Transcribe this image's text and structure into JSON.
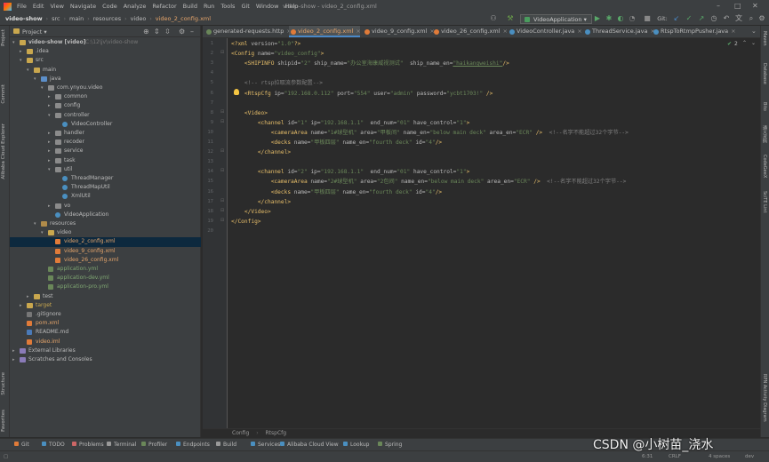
{
  "window": {
    "title": "video-show - video_2_config.xml",
    "menus": [
      "File",
      "Edit",
      "View",
      "Navigate",
      "Code",
      "Analyze",
      "Refactor",
      "Build",
      "Run",
      "Tools",
      "Git",
      "Window",
      "Help"
    ]
  },
  "breadcrumbs": [
    "video-show",
    "src",
    "main",
    "resources",
    "video",
    "video_2_config.xml"
  ],
  "toolbar": {
    "run_config": "VideoApplication",
    "git_label": "Git:"
  },
  "left_strip": [
    "Project",
    "Commit",
    "Alibaba Cloud Explorer",
    "Structure",
    "Favorites"
  ],
  "project_panel": {
    "title": "Project",
    "tree": [
      {
        "label": "video-show [video]",
        "extra": "C:\\12\\jv\\video-show",
        "type": "folder",
        "arrow": "▾"
      },
      {
        "label": ".idea",
        "type": "folder",
        "arrow": "▸"
      },
      {
        "label": "src",
        "type": "folder",
        "arrow": "▾"
      },
      {
        "label": "main",
        "type": "folder",
        "arrow": "▾"
      },
      {
        "label": "java",
        "type": "src",
        "arrow": "▾"
      },
      {
        "label": "com.ynyou.video",
        "type": "pkg",
        "arrow": "▾"
      },
      {
        "label": "common",
        "type": "pkg",
        "arrow": "▸"
      },
      {
        "label": "config",
        "type": "pkg",
        "arrow": "▸"
      },
      {
        "label": "controller",
        "type": "pkg",
        "arrow": "▾"
      },
      {
        "label": "VideoController",
        "type": "cls",
        "arrow": ""
      },
      {
        "label": "handler",
        "type": "pkg",
        "arrow": "▸"
      },
      {
        "label": "recoder",
        "type": "pkg",
        "arrow": "▸"
      },
      {
        "label": "service",
        "type": "pkg",
        "arrow": "▸"
      },
      {
        "label": "task",
        "type": "pkg",
        "arrow": "▸"
      },
      {
        "label": "util",
        "type": "pkg",
        "arrow": "▾"
      },
      {
        "label": "ThreadManager",
        "type": "cls",
        "arrow": ""
      },
      {
        "label": "ThreadMapUtil",
        "type": "cls",
        "arrow": ""
      },
      {
        "label": "XmlUtil",
        "type": "cls",
        "arrow": ""
      },
      {
        "label": "vo",
        "type": "pkg",
        "arrow": "▸"
      },
      {
        "label": "VideoApplication",
        "type": "cls",
        "arrow": ""
      },
      {
        "label": "resources",
        "type": "res",
        "arrow": "▾"
      },
      {
        "label": "video",
        "type": "folder",
        "arrow": "▾"
      },
      {
        "label": "video_2_config.xml",
        "type": "xml",
        "arrow": "",
        "selected": true
      },
      {
        "label": "video_9_config.xml",
        "type": "xml",
        "arrow": ""
      },
      {
        "label": "video_26_config.xml",
        "type": "xml",
        "arrow": ""
      },
      {
        "label": "application.yml",
        "type": "yml",
        "arrow": ""
      },
      {
        "label": "application-dev.yml",
        "type": "yml",
        "arrow": ""
      },
      {
        "label": "application-pro.yml",
        "type": "yml",
        "arrow": ""
      },
      {
        "label": "test",
        "type": "folder",
        "arrow": "▸"
      },
      {
        "label": "target",
        "type": "folder",
        "arrow": "▸"
      },
      {
        "label": ".gitignore",
        "type": "git",
        "arrow": ""
      },
      {
        "label": "pom.xml",
        "type": "xml",
        "arrow": ""
      },
      {
        "label": "README.md",
        "type": "md",
        "arrow": ""
      },
      {
        "label": "video.iml",
        "type": "xml",
        "arrow": ""
      },
      {
        "label": "External Libraries",
        "type": "lib",
        "arrow": "▸"
      },
      {
        "label": "Scratches and Consoles",
        "type": "lib",
        "arrow": "▸"
      }
    ]
  },
  "tabs": [
    {
      "label": "generated-requests.http",
      "color": "#6a8759"
    },
    {
      "label": "video_2_config.xml",
      "color": "#e07b39",
      "active": true
    },
    {
      "label": "video_9_config.xml",
      "color": "#e07b39"
    },
    {
      "label": "video_26_config.xml",
      "color": "#e07b39"
    },
    {
      "label": "VideoController.java",
      "color": "#4a8fc0"
    },
    {
      "label": "ThreadService.java",
      "color": "#4a8fc0"
    },
    {
      "label": "RtspToRtmpPusher.java",
      "color": "#4a8fc0"
    }
  ],
  "editor": {
    "inspection_count": "2",
    "lines": [
      [
        [
          "t-tag",
          "<?xml "
        ],
        [
          "t-attr",
          "version="
        ],
        [
          "t-val",
          "\"1.0\""
        ],
        [
          "t-tag",
          "?>"
        ]
      ],
      [
        [
          "t-tag",
          "<Config "
        ],
        [
          "t-attr",
          "name="
        ],
        [
          "t-val",
          "\"video_config\""
        ],
        [
          "t-tag",
          ">"
        ]
      ],
      [
        [
          "t-txt",
          "    "
        ],
        [
          "t-tag",
          "<SHIPINFO "
        ],
        [
          "t-attr",
          "shipid="
        ],
        [
          "t-val",
          "\"2\" "
        ],
        [
          "t-attr",
          "ship_name="
        ],
        [
          "t-val",
          "\"办公室海康威视测试\"  "
        ],
        [
          "t-attr",
          "ship_name_en="
        ],
        [
          "t-val t-ul",
          "\"haikangweishi\""
        ],
        [
          "t-tag",
          "/>"
        ]
      ],
      [],
      [
        [
          "t-com",
          "    <!-- rtsp拉取流参数配置-->"
        ]
      ],
      [
        [
          "t-txt",
          "    "
        ],
        [
          "t-tag",
          "<RtspCfg "
        ],
        [
          "t-attr",
          "ip="
        ],
        [
          "t-val",
          "\"192.168.0.112\" "
        ],
        [
          "t-attr",
          "port="
        ],
        [
          "t-val",
          "\"554\" "
        ],
        [
          "t-attr",
          "user="
        ],
        [
          "t-val",
          "\"admin\" "
        ],
        [
          "t-attr",
          "password="
        ],
        [
          "t-val",
          "\"ycbt1703!\" "
        ],
        [
          "t-tag",
          "/>"
        ]
      ],
      [],
      [
        [
          "t-txt",
          "    "
        ],
        [
          "t-tag",
          "<Video>"
        ]
      ],
      [
        [
          "t-txt",
          "        "
        ],
        [
          "t-tag",
          "<channel "
        ],
        [
          "t-attr",
          "id="
        ],
        [
          "t-val",
          "\"1\" "
        ],
        [
          "t-attr",
          "ip="
        ],
        [
          "t-val",
          "\"192.168.1.1\"  "
        ],
        [
          "t-attr",
          "end_num="
        ],
        [
          "t-val",
          "\"01\" "
        ],
        [
          "t-attr",
          "have_control="
        ],
        [
          "t-val",
          "\"1\""
        ],
        [
          "t-tag",
          ">"
        ]
      ],
      [
        [
          "t-txt",
          "            "
        ],
        [
          "t-tag",
          "<cameraArea "
        ],
        [
          "t-attr",
          "name="
        ],
        [
          "t-val",
          "\"1#球型机\" "
        ],
        [
          "t-attr",
          "area="
        ],
        [
          "t-val",
          "\"甲板间\" "
        ],
        [
          "t-attr",
          "name_en="
        ],
        [
          "t-val",
          "\"below main deck\" "
        ],
        [
          "t-attr",
          "area_en="
        ],
        [
          "t-val",
          "\"ECR\" "
        ],
        [
          "t-tag",
          "/>"
        ],
        [
          "t-com",
          "  <!--名字不能超过32个字节-->"
        ]
      ],
      [
        [
          "t-txt",
          "            "
        ],
        [
          "t-tag",
          "<decks "
        ],
        [
          "t-attr",
          "name="
        ],
        [
          "t-val",
          "\"甲板四层\" "
        ],
        [
          "t-attr",
          "name_en="
        ],
        [
          "t-val",
          "\"fourth deck\" "
        ],
        [
          "t-attr",
          "id="
        ],
        [
          "t-val",
          "\"4\""
        ],
        [
          "t-tag",
          "/>"
        ]
      ],
      [
        [
          "t-txt",
          "        "
        ],
        [
          "t-tag",
          "</channel>"
        ]
      ],
      [],
      [
        [
          "t-txt",
          "        "
        ],
        [
          "t-tag",
          "<channel "
        ],
        [
          "t-attr",
          "id="
        ],
        [
          "t-val",
          "\"2\" "
        ],
        [
          "t-attr",
          "ip="
        ],
        [
          "t-val",
          "\"192.168.1.1\"  "
        ],
        [
          "t-attr",
          "end_num="
        ],
        [
          "t-val",
          "\"01\" "
        ],
        [
          "t-attr",
          "have_control="
        ],
        [
          "t-val",
          "\"1\""
        ],
        [
          "t-tag",
          ">"
        ]
      ],
      [
        [
          "t-txt",
          "            "
        ],
        [
          "t-tag",
          "<cameraArea "
        ],
        [
          "t-attr",
          "name="
        ],
        [
          "t-val",
          "\"2#球型机\" "
        ],
        [
          "t-attr",
          "area="
        ],
        [
          "t-val",
          "\"2包间\" "
        ],
        [
          "t-attr",
          "name_en="
        ],
        [
          "t-val",
          "\"below main deck\" "
        ],
        [
          "t-attr",
          "area_en="
        ],
        [
          "t-val",
          "\"ECR\" "
        ],
        [
          "t-tag",
          "/>"
        ],
        [
          "t-com",
          "  <!--名字不能超过32个字节-->"
        ]
      ],
      [
        [
          "t-txt",
          "            "
        ],
        [
          "t-tag",
          "<decks "
        ],
        [
          "t-attr",
          "name="
        ],
        [
          "t-val",
          "\"甲板四层\" "
        ],
        [
          "t-attr",
          "name_en="
        ],
        [
          "t-val",
          "\"fourth deck\" "
        ],
        [
          "t-attr",
          "id="
        ],
        [
          "t-val",
          "\"4\""
        ],
        [
          "t-tag",
          "/>"
        ]
      ],
      [
        [
          "t-txt",
          "        "
        ],
        [
          "t-tag",
          "</channel>"
        ]
      ],
      [
        [
          "t-txt",
          "    "
        ],
        [
          "t-tag",
          "</Video>"
        ]
      ],
      [
        [
          "t-tag",
          "</Config>"
        ]
      ],
      []
    ]
  },
  "editor_breadcrumb": [
    "Config",
    "RtspCfg"
  ],
  "right_strip": [
    "Maven",
    "Database",
    "Bito",
    "通义灵码",
    "CodeGeeX",
    "SciTE Lint",
    "RPN Activity Diagram"
  ],
  "bottom_tools": [
    {
      "label": "Git",
      "color": "#e07b39"
    },
    {
      "label": "TODO",
      "color": "#4a8fc0"
    },
    {
      "label": "Problems",
      "color": "#cc6666"
    },
    {
      "label": "Terminal",
      "color": "#999999"
    },
    {
      "label": "Profiler",
      "color": "#6a8759"
    },
    {
      "label": "Endpoints",
      "color": "#4a8fc0"
    },
    {
      "label": "Build",
      "color": "#999999"
    },
    {
      "label": "Services",
      "color": "#4a8fc0"
    },
    {
      "label": "Alibaba Cloud View",
      "color": "#4a8fc0"
    },
    {
      "label": "Lookup",
      "color": "#4a8fc0"
    },
    {
      "label": "Spring",
      "color": "#6a8759"
    }
  ],
  "statusbar": {
    "position": "6:31",
    "line_sep": "CRLF",
    "indent": "4 spaces",
    "branch": "dev"
  },
  "watermark": "CSDN @小树苗_浇水"
}
